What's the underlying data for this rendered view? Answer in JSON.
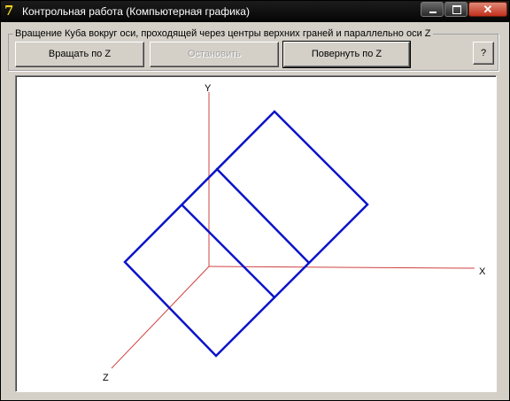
{
  "window": {
    "title": "Контрольная работа (Компьютерная графика)",
    "app_icon_glyph": "7",
    "close_glyph": "✕"
  },
  "group": {
    "caption": "Вращение Куба вокруг оси, проходящей через центры верхних граней и параллельно оси Z"
  },
  "buttons": {
    "rotate_z": "Вращать по Z",
    "stop": "Остановить",
    "turn_z": "Повернуть по Z",
    "help": "?"
  },
  "canvas": {
    "axes": {
      "x_label": "X",
      "y_label": "Y",
      "z_label": "Z"
    },
    "colors": {
      "axis": "#d04040",
      "cube": "#0a14c8",
      "background": "#ffffff"
    }
  }
}
